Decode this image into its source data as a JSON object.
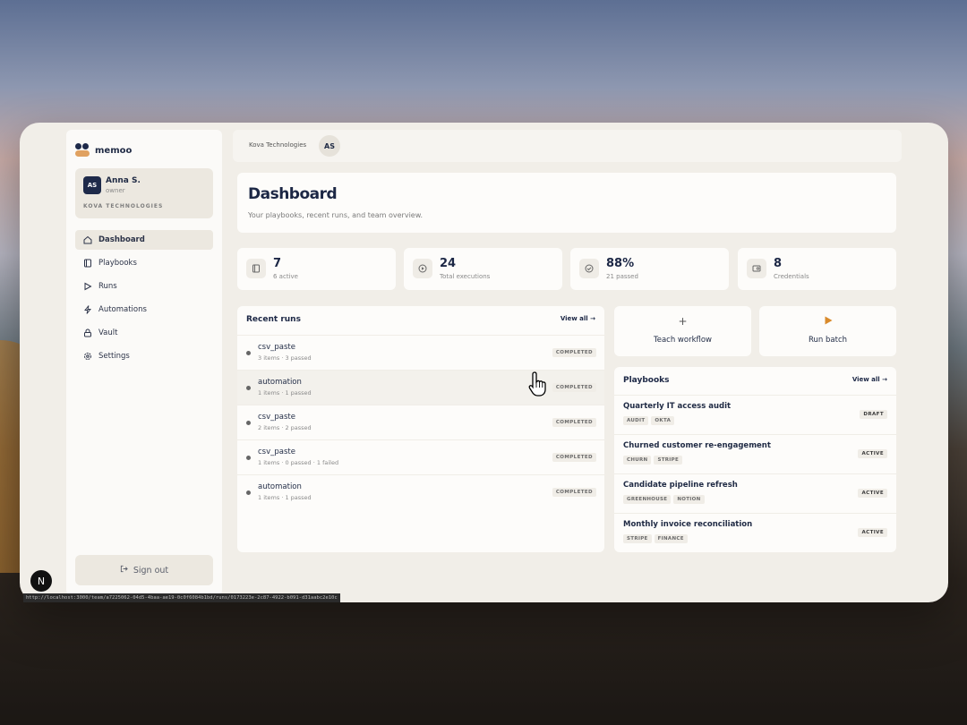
{
  "app": {
    "name": "memoo"
  },
  "user": {
    "initials": "AS",
    "name": "Anna S.",
    "role": "owner",
    "org": "KOVA TECHNOLOGIES"
  },
  "nav": [
    {
      "label": "Dashboard",
      "icon": "home-icon",
      "active": true
    },
    {
      "label": "Playbooks",
      "icon": "book-icon"
    },
    {
      "label": "Runs",
      "icon": "play-icon"
    },
    {
      "label": "Automations",
      "icon": "bolt-icon"
    },
    {
      "label": "Vault",
      "icon": "lock-icon"
    },
    {
      "label": "Settings",
      "icon": "gear-icon"
    }
  ],
  "signout": "Sign out",
  "topbar": {
    "org": "Kova Technologies",
    "avatar": "AS"
  },
  "header": {
    "title": "Dashboard",
    "subtitle": "Your playbooks, recent runs, and team overview."
  },
  "stats": [
    {
      "value": "7",
      "label": "6 active",
      "icon": "book-icon"
    },
    {
      "value": "24",
      "label": "Total executions",
      "icon": "play-circle-icon"
    },
    {
      "value": "88%",
      "label": "21 passed",
      "icon": "check-circle-icon"
    },
    {
      "value": "8",
      "label": "Credentials",
      "icon": "credential-icon"
    }
  ],
  "recent_runs": {
    "title": "Recent runs",
    "view_all": "View all →",
    "rows": [
      {
        "name": "csv_paste",
        "meta": "3 items · 3 passed",
        "status": "COMPLETED"
      },
      {
        "name": "automation",
        "meta": "1 items · 1 passed",
        "status": "COMPLETED"
      },
      {
        "name": "csv_paste",
        "meta": "2 items · 2 passed",
        "status": "COMPLETED"
      },
      {
        "name": "csv_paste",
        "meta": "1 items · 0 passed · 1 failed",
        "status": "COMPLETED"
      },
      {
        "name": "automation",
        "meta": "1 items · 1 passed",
        "status": "COMPLETED"
      }
    ]
  },
  "actions": {
    "teach": "Teach workflow",
    "batch": "Run batch"
  },
  "playbooks": {
    "title": "Playbooks",
    "view_all": "View all →",
    "rows": [
      {
        "name": "Quarterly IT access audit",
        "tags": [
          "AUDIT",
          "OKTA"
        ],
        "status": "DRAFT"
      },
      {
        "name": "Churned customer re-engagement",
        "tags": [
          "CHURN",
          "STRIPE"
        ],
        "status": "ACTIVE"
      },
      {
        "name": "Candidate pipeline refresh",
        "tags": [
          "GREENHOUSE",
          "NOTION"
        ],
        "status": "ACTIVE"
      },
      {
        "name": "Monthly invoice reconciliation",
        "tags": [
          "STRIPE",
          "FINANCE"
        ],
        "status": "ACTIVE"
      }
    ]
  },
  "statusbar": {
    "url": "http://localhost:3000/team/a7225062-04d5-4baa-ae19-0c0f6084b1bd/runs/0173223e-2c87-4922-b091-d31aabc2e10c"
  },
  "colors": {
    "accent": "#1e2a4a",
    "brand_orange": "#e0a160",
    "play_orange": "#d98a2b"
  }
}
